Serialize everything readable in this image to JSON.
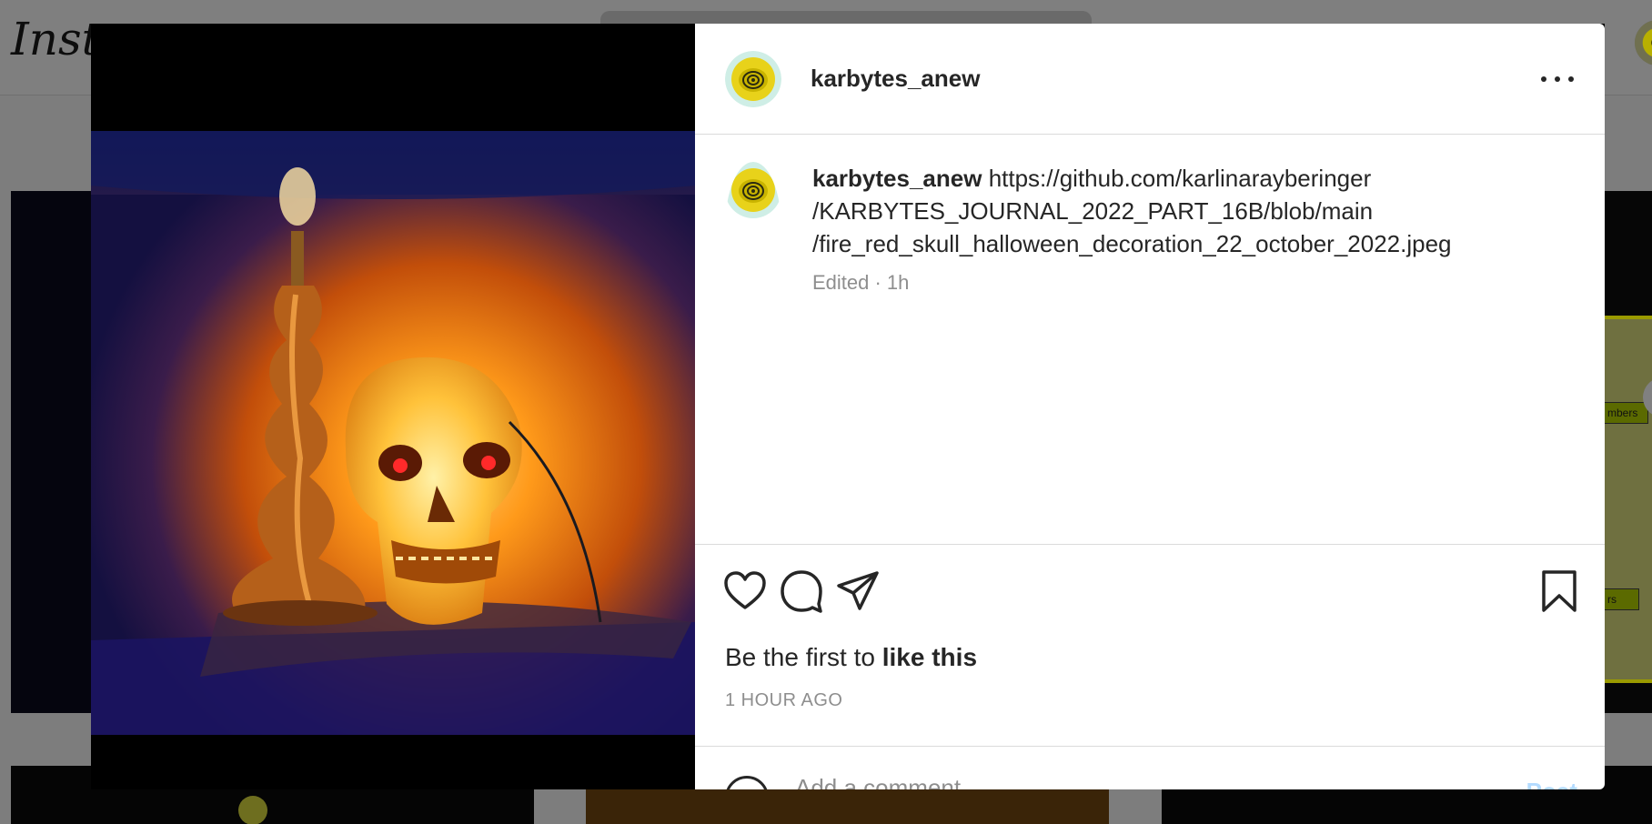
{
  "background": {
    "logo_text": "Insta",
    "tag_1": "mbers",
    "tag_2": "rs"
  },
  "post": {
    "username": "karbytes_anew",
    "caption_username": "karbytes_anew",
    "caption_text": "https://github.com/karlinarayberinger/KARBYTES_JOURNAL_2022_PART_16B/blob/main/fire_red_skull_halloween_decoration_22_october_2022.jpeg",
    "caption_line_1": "https://github.com/karlinarayberinger",
    "caption_line_2": "/KARBYTES_JOURNAL_2022_PART_16B/blob/main",
    "caption_line_3": "/fire_red_skull_halloween_decoration_22_october_2022.jpeg",
    "caption_meta": "Edited · 1h",
    "likes_prefix": "Be the first to ",
    "likes_bold": "like this",
    "timestamp": "1 HOUR AGO"
  },
  "icons": {
    "more": "more-options-icon",
    "like": "heart-icon",
    "comment": "comment-icon",
    "share": "paper-plane-icon",
    "save": "bookmark-icon"
  },
  "comment": {
    "placeholder": "Add a comment…",
    "post_label": "Post"
  },
  "colors": {
    "link_blue": "#b3dbff",
    "muted_text": "#8e8e8e",
    "text": "#262626",
    "divider": "#dbdbdb"
  }
}
